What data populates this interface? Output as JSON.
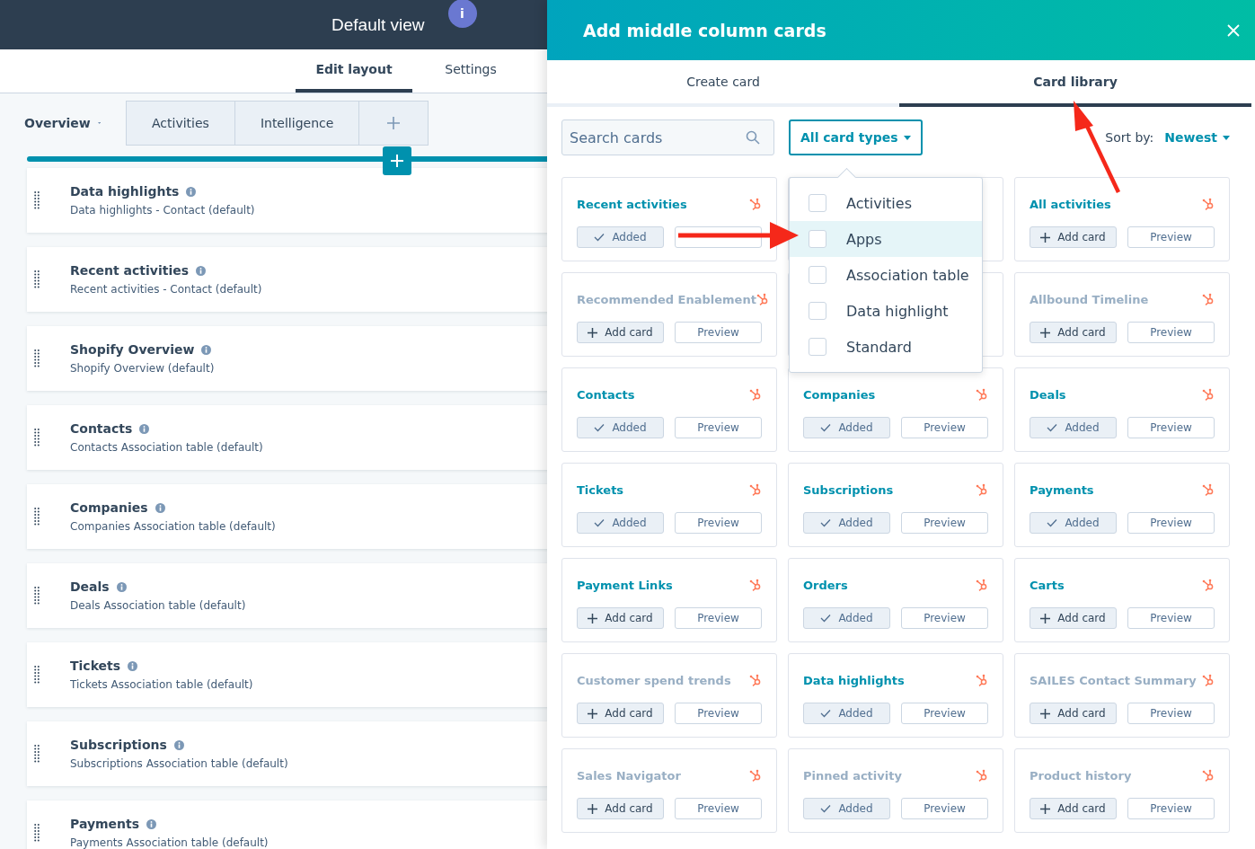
{
  "page": {
    "title": "Default view",
    "info_badge": "i",
    "tabs": [
      {
        "label": "Edit layout",
        "selected": true
      },
      {
        "label": "Settings",
        "selected": false
      }
    ],
    "section_tabs": [
      {
        "label": "Overview",
        "selected": true
      },
      {
        "label": "Activities",
        "selected": false
      },
      {
        "label": "Intelligence",
        "selected": false
      }
    ],
    "cards": [
      {
        "title": "Data highlights",
        "subtitle": "Data highlights - Contact (default)"
      },
      {
        "title": "Recent activities",
        "subtitle": "Recent activities - Contact (default)"
      },
      {
        "title": "Shopify Overview",
        "subtitle": "Shopify Overview (default)"
      },
      {
        "title": "Contacts",
        "subtitle": "Contacts Association table (default)"
      },
      {
        "title": "Companies",
        "subtitle": "Companies Association table (default)"
      },
      {
        "title": "Deals",
        "subtitle": "Deals Association table (default)"
      },
      {
        "title": "Tickets",
        "subtitle": "Tickets Association table (default)"
      },
      {
        "title": "Subscriptions",
        "subtitle": "Subscriptions Association table (default)"
      },
      {
        "title": "Payments",
        "subtitle": "Payments Association table (default)"
      }
    ]
  },
  "drawer": {
    "title": "Add middle column cards",
    "tabs": [
      {
        "label": "Create card",
        "selected": false
      },
      {
        "label": "Card library",
        "selected": true
      }
    ],
    "search": {
      "placeholder": "Search cards"
    },
    "filter": {
      "label": "All card types"
    },
    "sort": {
      "label": "Sort by:",
      "value": "Newest"
    },
    "filter_menu": [
      {
        "label": "Activities",
        "checked": false,
        "highlighted": false
      },
      {
        "label": "Apps",
        "checked": false,
        "highlighted": true
      },
      {
        "label": "Association table",
        "checked": false,
        "highlighted": false
      },
      {
        "label": "Data highlight",
        "checked": false,
        "highlighted": false
      },
      {
        "label": "Standard",
        "checked": false,
        "highlighted": false
      }
    ],
    "cards": [
      {
        "kind": "card",
        "title": "Recent activities",
        "dimmed": false,
        "added": true,
        "action": "Added"
      },
      {
        "kind": "covered"
      },
      {
        "kind": "card",
        "title": "All activities",
        "dimmed": false,
        "added": false,
        "action": "Add card",
        "preview": "Preview"
      },
      {
        "kind": "card",
        "title": "Recommended Enablement",
        "dimmed": true,
        "added": false,
        "action": "Add card",
        "preview": "Preview"
      },
      {
        "kind": "covered"
      },
      {
        "kind": "card",
        "title": "Allbound Timeline",
        "dimmed": true,
        "added": false,
        "action": "Add card",
        "preview": "Preview"
      },
      {
        "kind": "card",
        "title": "Contacts",
        "dimmed": false,
        "added": true,
        "action": "Added",
        "preview": "Preview"
      },
      {
        "kind": "card",
        "title": "Companies",
        "dimmed": false,
        "added": true,
        "action": "Added",
        "preview": "Preview"
      },
      {
        "kind": "card",
        "title": "Deals",
        "dimmed": false,
        "added": true,
        "action": "Added",
        "preview": "Preview"
      },
      {
        "kind": "card",
        "title": "Tickets",
        "dimmed": false,
        "added": true,
        "action": "Added",
        "preview": "Preview"
      },
      {
        "kind": "card",
        "title": "Subscriptions",
        "dimmed": false,
        "added": true,
        "action": "Added",
        "preview": "Preview"
      },
      {
        "kind": "card",
        "title": "Payments",
        "dimmed": false,
        "added": true,
        "action": "Added",
        "preview": "Preview"
      },
      {
        "kind": "card",
        "title": "Payment Links",
        "dimmed": false,
        "added": false,
        "action": "Add card",
        "preview": "Preview"
      },
      {
        "kind": "card",
        "title": "Orders",
        "dimmed": false,
        "added": true,
        "action": "Added",
        "preview": "Preview"
      },
      {
        "kind": "card",
        "title": "Carts",
        "dimmed": false,
        "added": false,
        "action": "Add card",
        "preview": "Preview"
      },
      {
        "kind": "card",
        "title": "Customer spend trends",
        "dimmed": true,
        "added": false,
        "action": "Add card",
        "preview": "Preview"
      },
      {
        "kind": "card",
        "title": "Data highlights",
        "dimmed": false,
        "added": true,
        "action": "Added",
        "preview": "Preview"
      },
      {
        "kind": "card",
        "title": "SAILES Contact Summary",
        "dimmed": true,
        "added": false,
        "action": "Add card",
        "preview": "Preview"
      },
      {
        "kind": "card",
        "title": "Sales Navigator",
        "dimmed": true,
        "added": false,
        "action": "Add card",
        "preview": "Preview"
      },
      {
        "kind": "card",
        "title": "Pinned activity",
        "dimmed": true,
        "added": true,
        "action": "Added",
        "preview": "Preview"
      },
      {
        "kind": "card",
        "title": "Product history",
        "dimmed": true,
        "added": false,
        "action": "Add card",
        "preview": "Preview"
      }
    ]
  }
}
